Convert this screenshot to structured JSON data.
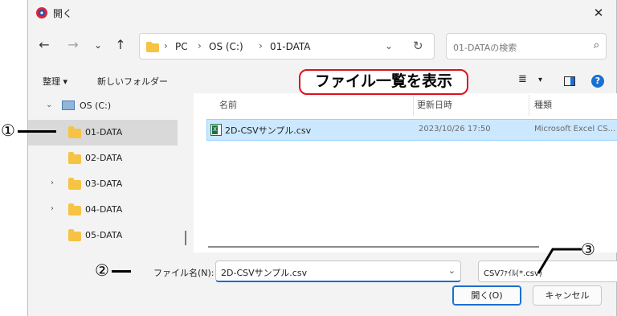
{
  "window": {
    "title": "開く",
    "close_glyph": "✕"
  },
  "nav": {
    "back": "←",
    "forward": "→",
    "recent": "⌄",
    "up": "↑"
  },
  "address": {
    "crumbs": [
      "PC",
      "OS (C:)",
      "01-DATA"
    ],
    "sep": "›",
    "dropdown": "⌄",
    "refresh": "↻"
  },
  "search": {
    "placeholder": "01-DATAの検索",
    "icon": "⌕"
  },
  "toolbar": {
    "organize": "整理 ▾",
    "new_folder": "新しいフォルダー",
    "view_icon": "≣",
    "view_dd": "▾",
    "help": "?"
  },
  "tree": {
    "chevron_expanded": "⌄",
    "chevron_collapsed": "›",
    "items": [
      {
        "label": "OS (C:)"
      },
      {
        "label": "01-DATA"
      },
      {
        "label": "02-DATA"
      },
      {
        "label": "03-DATA"
      },
      {
        "label": "04-DATA"
      },
      {
        "label": "05-DATA"
      }
    ]
  },
  "columns": {
    "name": "名前",
    "modified": "更新日時",
    "type": "種類",
    "sort_glyph": "^"
  },
  "files": [
    {
      "name": "2D-CSVサンプル.csv",
      "modified": "2023/10/26 17:50",
      "type": "Microsoft Excel CS..."
    }
  ],
  "excel_badge": "X",
  "bottom": {
    "filename_label": "ファイル名(N):",
    "filename_value": "2D-CSVサンプル.csv",
    "dropdown": "⌄",
    "filetype_value": "CSVﾌｧｲﾙ(*.csv)",
    "open_button": "開く(O)",
    "cancel_button": "キャンセル"
  },
  "annotations": {
    "callout_text": "ファイル一覧を表示",
    "marker1": "①",
    "marker2": "②",
    "marker3": "③"
  },
  "colors": {
    "accent": "#1b6fd1",
    "selection": "#cce8ff",
    "callout_border": "#e0101f",
    "folder": "#f6c343"
  }
}
